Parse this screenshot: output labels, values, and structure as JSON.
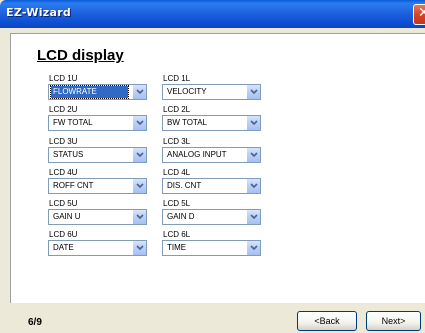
{
  "window": {
    "title": "EZ-Wizard"
  },
  "page": {
    "heading": "LCD display",
    "progress": "6/9"
  },
  "fields": {
    "lcd1u": {
      "label": "LCD 1U",
      "value": "FLOWRATE"
    },
    "lcd1l": {
      "label": "LCD 1L",
      "value": "VELOCITY"
    },
    "lcd2u": {
      "label": "LCD 2U",
      "value": "FW TOTAL"
    },
    "lcd2l": {
      "label": "LCD 2L",
      "value": "BW TOTAL"
    },
    "lcd3u": {
      "label": "LCD 3U",
      "value": "STATUS"
    },
    "lcd3l": {
      "label": "LCD 3L",
      "value": "ANALOG INPUT"
    },
    "lcd4u": {
      "label": "LCD 4U",
      "value": "ROFF CNT"
    },
    "lcd4l": {
      "label": "LCD 4L",
      "value": "DIS. CNT"
    },
    "lcd5u": {
      "label": "LCD 5U",
      "value": "GAIN U"
    },
    "lcd5l": {
      "label": "LCD 5L",
      "value": "GAIN D"
    },
    "lcd6u": {
      "label": "LCD 6U",
      "value": "DATE"
    },
    "lcd6l": {
      "label": "LCD 6L",
      "value": "TIME"
    }
  },
  "buttons": {
    "back": "<Back",
    "next": "Next>"
  },
  "colors": {
    "titlebar": "#0d4fd2",
    "selection": "#316ac5",
    "close": "#d4452a"
  },
  "icons": {
    "close": "close-icon",
    "dropdown": "chevron-down-icon"
  }
}
